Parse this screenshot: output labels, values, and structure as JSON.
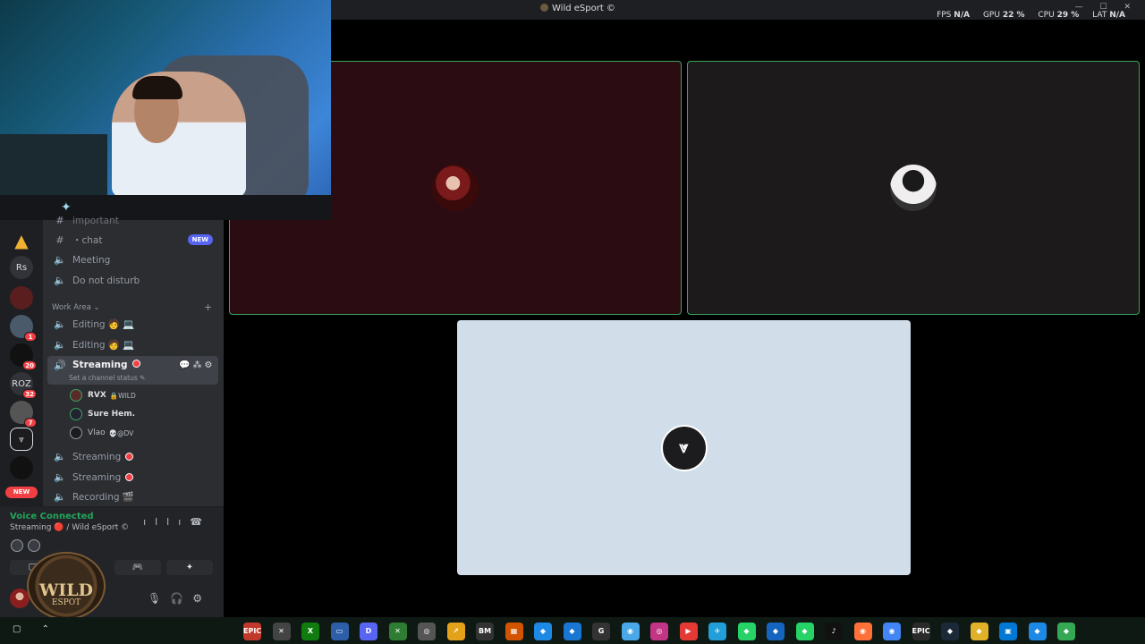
{
  "titlebar": {
    "title": "Wild eSport ©",
    "stats": [
      {
        "label": "FPS",
        "value": "N/A"
      },
      {
        "label": "GPU",
        "value": "22 %"
      },
      {
        "label": "CPU",
        "value": "29 %"
      },
      {
        "label": "LAT",
        "value": "N/A"
      }
    ],
    "window_controls": "— ☐ ✕"
  },
  "guilds": [
    {
      "icon": "warning-icon",
      "glyph": "▲"
    },
    {
      "label": "Rs"
    },
    {
      "icon": "server-icon"
    },
    {
      "icon": "server-icon",
      "badge": "1"
    },
    {
      "icon": "server-icon",
      "badge": "20"
    },
    {
      "label": "ROZ",
      "badge": "32"
    },
    {
      "icon": "server-icon",
      "badge": "7"
    },
    {
      "label": "⩔"
    },
    {
      "icon": "server-icon"
    }
  ],
  "guild_new_label": "NEW",
  "channels": {
    "partial_top": "important",
    "chat": {
      "name": "・chat",
      "badge": "NEW"
    },
    "meeting": "Meeting",
    "do_not_disturb": "Do not disturb",
    "category": "Work Area",
    "editing_1": "Editing 🧑 💻",
    "editing_2": "Editing 🧑 💻",
    "streaming_active": "Streaming",
    "status_line": "Set a channel status ✎",
    "streaming_2": "Streaming",
    "streaming_3": "Streaming",
    "recording": "Recording 🎬"
  },
  "members": [
    {
      "name": "RVX",
      "tag": "🔒WILD"
    },
    {
      "name": "Sure Hem.",
      "tag": ""
    },
    {
      "name": "Vlao",
      "tag": "💀@DV"
    }
  ],
  "voice": {
    "title": "Voice Connected",
    "subtitle": "Streaming 🔴 / Wild eSport ©",
    "buttons": [
      "🖵",
      "🎮",
      "✦"
    ]
  },
  "logo": {
    "line1": "WILD",
    "line2": "ESPOT"
  },
  "tiles": [
    {
      "name": "tile-red-user"
    },
    {
      "name": "tile-dark-user"
    },
    {
      "name": "tile-logo-user",
      "logo_glyph": "⩔"
    }
  ],
  "taskbar": {
    "apps": [
      "EPIC",
      "✕",
      "X",
      "▭",
      "D",
      "✕",
      "◎",
      "↗",
      "BM",
      "▦",
      "◆",
      "◆",
      "G",
      "◉",
      "◎",
      "▶",
      "✈",
      "◆",
      "◆",
      "◆",
      "♪",
      "◉",
      "◉",
      "EPIC",
      "◆",
      "◆",
      "▣",
      "◆",
      "◆"
    ]
  },
  "colors": {
    "speaking": "#3ba55c",
    "live": "#f23f43",
    "blurple": "#5865f2"
  }
}
